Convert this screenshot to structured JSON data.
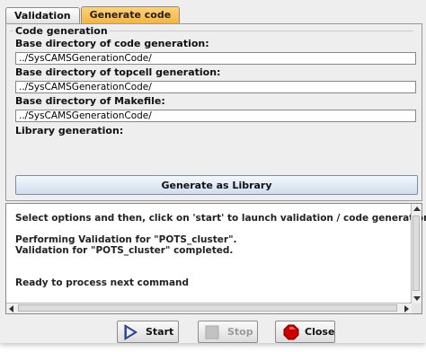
{
  "tabs": [
    {
      "label": "Validation",
      "active": false
    },
    {
      "label": "Generate code",
      "active": true
    }
  ],
  "code_generation": {
    "group_title": "Code generation",
    "base_dir_label": "Base directory of code generation:",
    "base_dir_value": "../SysCAMSGenerationCode/",
    "topcell_dir_label": "Base directory of topcell generation:",
    "topcell_dir_value": "../SysCAMSGenerationCode/",
    "makefile_dir_label": "Base directory of Makefile:",
    "makefile_dir_value": "../SysCAMSGenerationCode/",
    "library_label": "Library generation:",
    "library_button_label": "Generate as Library"
  },
  "console": {
    "lines": [
      "Select options and then, click on 'start' to launch validation / code generation",
      "",
      "Performing Validation for \"POTS_cluster\".",
      "Validation for \"POTS_cluster\" completed.",
      "",
      "",
      "Ready to process next command"
    ]
  },
  "buttons": {
    "start_label": "Start",
    "stop_label": "Stop",
    "close_label": "Close"
  },
  "colors": {
    "active_tab": "#f6b33a",
    "close_icon": "#cc0000"
  }
}
